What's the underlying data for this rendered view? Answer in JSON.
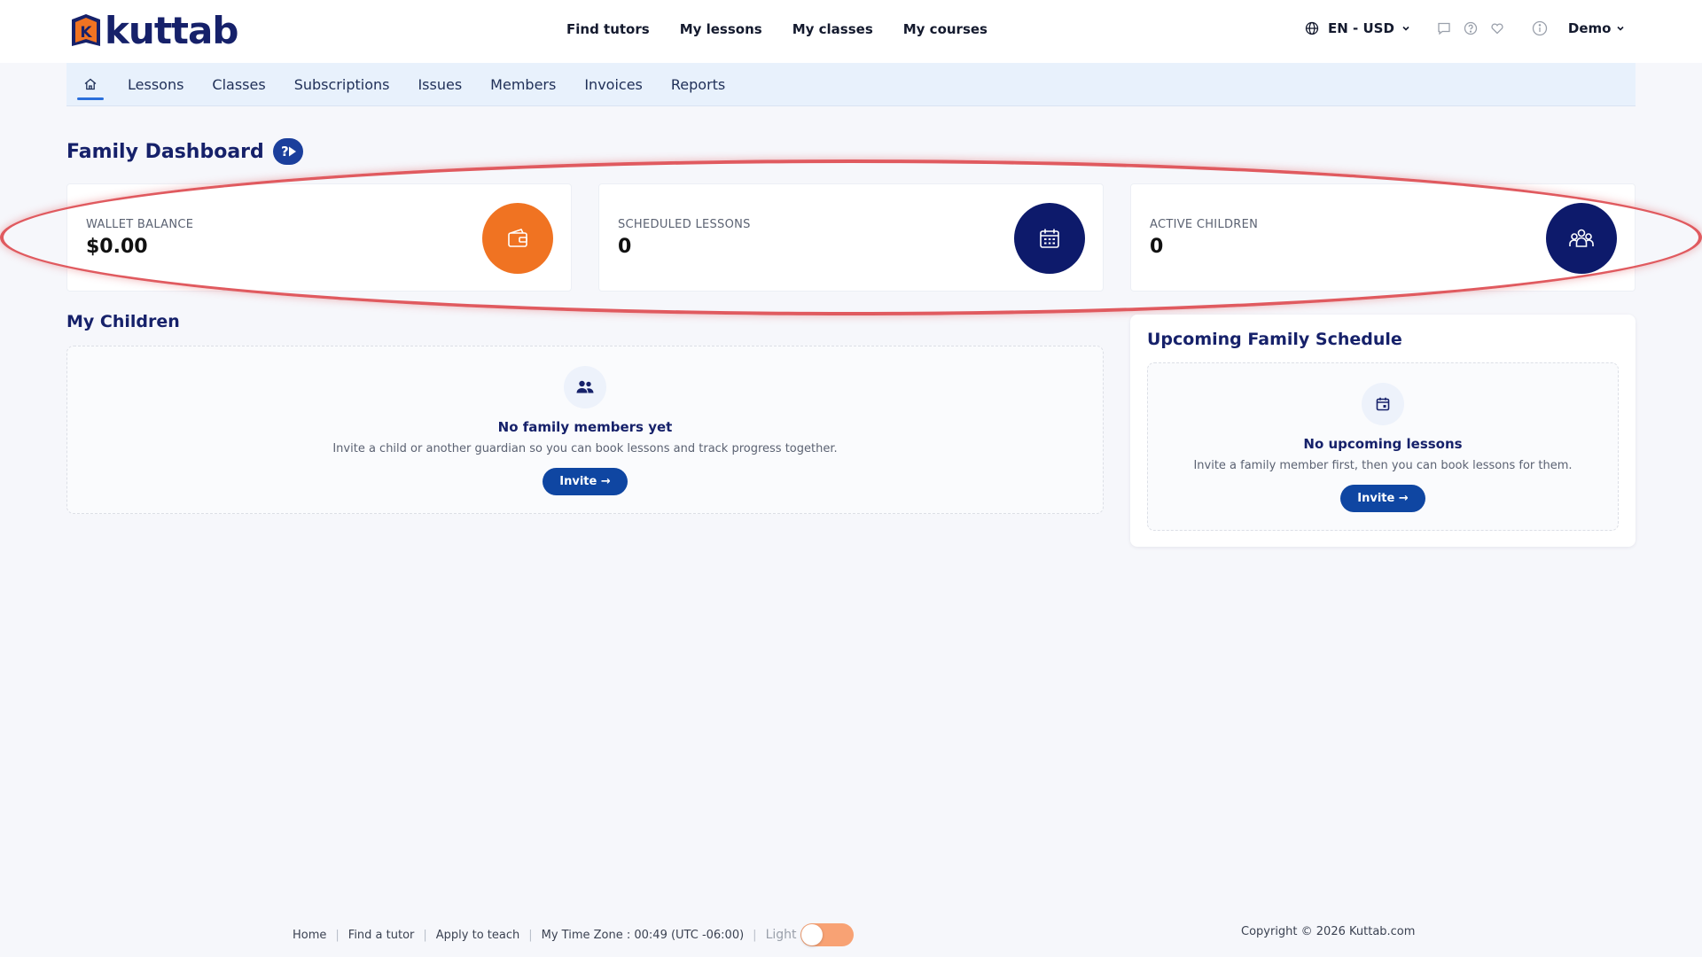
{
  "brand": {
    "name": "kuttab",
    "mark_letter": "K"
  },
  "main_nav": [
    {
      "label": "Find tutors"
    },
    {
      "label": "My lessons"
    },
    {
      "label": "My classes"
    },
    {
      "label": "My courses"
    }
  ],
  "header_right": {
    "language_currency": "EN - USD",
    "user_name": "Demo"
  },
  "sub_nav": [
    {
      "label": "Lessons"
    },
    {
      "label": "Classes"
    },
    {
      "label": "Subscriptions"
    },
    {
      "label": "Issues"
    },
    {
      "label": "Members"
    },
    {
      "label": "Invoices"
    },
    {
      "label": "Reports"
    }
  ],
  "page": {
    "title": "Family Dashboard"
  },
  "stats": [
    {
      "label": "WALLET BALANCE",
      "value": "$0.00",
      "icon": "wallet-icon",
      "color": "#f07322"
    },
    {
      "label": "SCHEDULED LESSONS",
      "value": "0",
      "icon": "calendar-icon",
      "color": "#0d1a6b"
    },
    {
      "label": "ACTIVE CHILDREN",
      "value": "0",
      "icon": "children-icon",
      "color": "#0d1a6b"
    }
  ],
  "children_section": {
    "title": "My Children",
    "empty_title": "No family members yet",
    "empty_desc": "Invite a child or another guardian so you can book lessons and track progress together.",
    "button": "Invite →"
  },
  "schedule_section": {
    "title": "Upcoming Family Schedule",
    "empty_title": "No upcoming lessons",
    "empty_desc": "Invite a family member first, then you can book lessons for them.",
    "button": "Invite →"
  },
  "footer": {
    "links": [
      "Home",
      "Find a tutor",
      "Apply to teach"
    ],
    "timezone": "My Time Zone : 00:49 (UTC -06:00)",
    "theme_label": "Light",
    "copyright": "Copyright © 2026 Kuttab.com"
  },
  "colors": {
    "accent": "#0f46a2",
    "brand_navy": "#16216a",
    "orange": "#f07322",
    "annotation": "#e05a5f"
  }
}
